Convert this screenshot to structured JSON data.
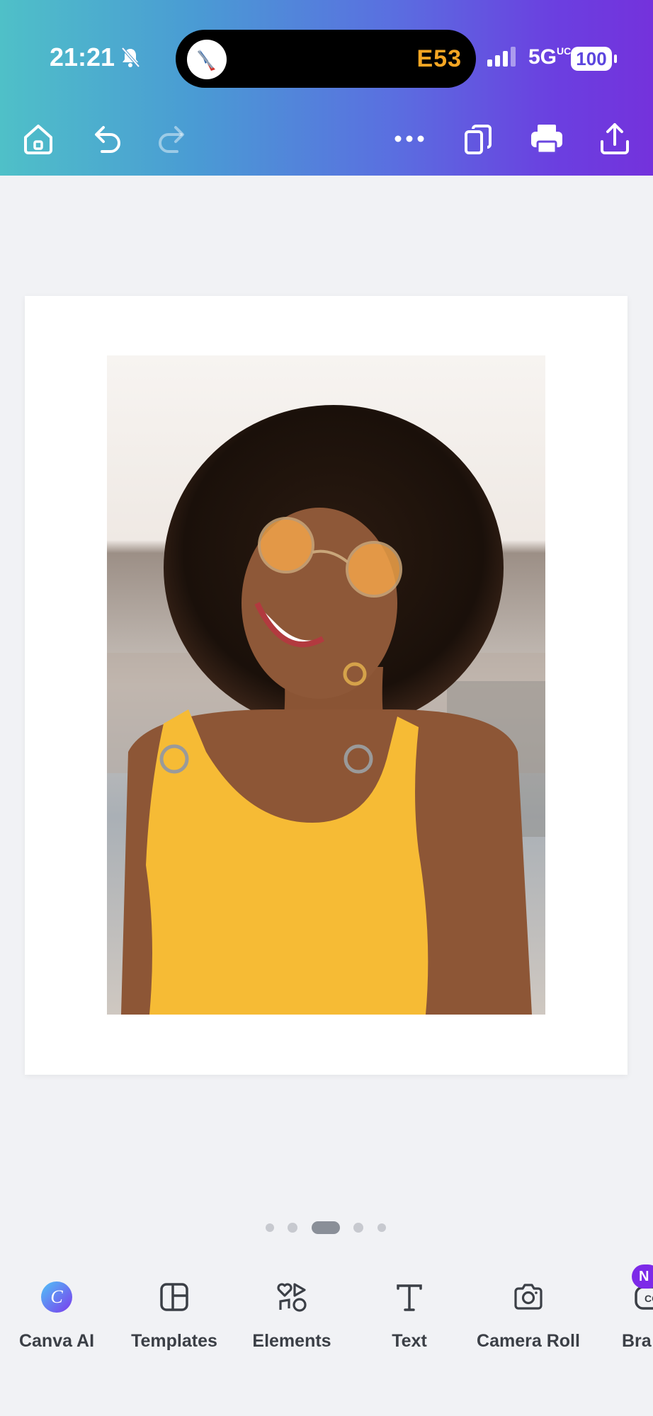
{
  "status_bar": {
    "time": "21:21",
    "activity_text": "E53",
    "network": "5G",
    "network_suffix": "UC",
    "battery": "100"
  },
  "editor_toolbar": {
    "icons": [
      "home-icon",
      "undo-icon",
      "redo-icon",
      "more-icon",
      "pages-icon",
      "print-icon",
      "share-icon"
    ]
  },
  "canvas": {
    "page_indicator": {
      "count": 5,
      "active": 3
    }
  },
  "bottom_toolbar": {
    "items": [
      {
        "label": "Canva AI",
        "icon": "canva-ai-icon"
      },
      {
        "label": "Templates",
        "icon": "templates-icon"
      },
      {
        "label": "Elements",
        "icon": "elements-icon"
      },
      {
        "label": "Text",
        "icon": "text-icon"
      },
      {
        "label": "Camera Roll",
        "icon": "camera-icon"
      },
      {
        "label": "Bra",
        "icon": "brand-icon"
      }
    ],
    "badge": "N"
  },
  "colors": {
    "accent": "#7d2ae8",
    "header_gradient_start": "#4fc0c8",
    "header_gradient_end": "#7432dc"
  }
}
